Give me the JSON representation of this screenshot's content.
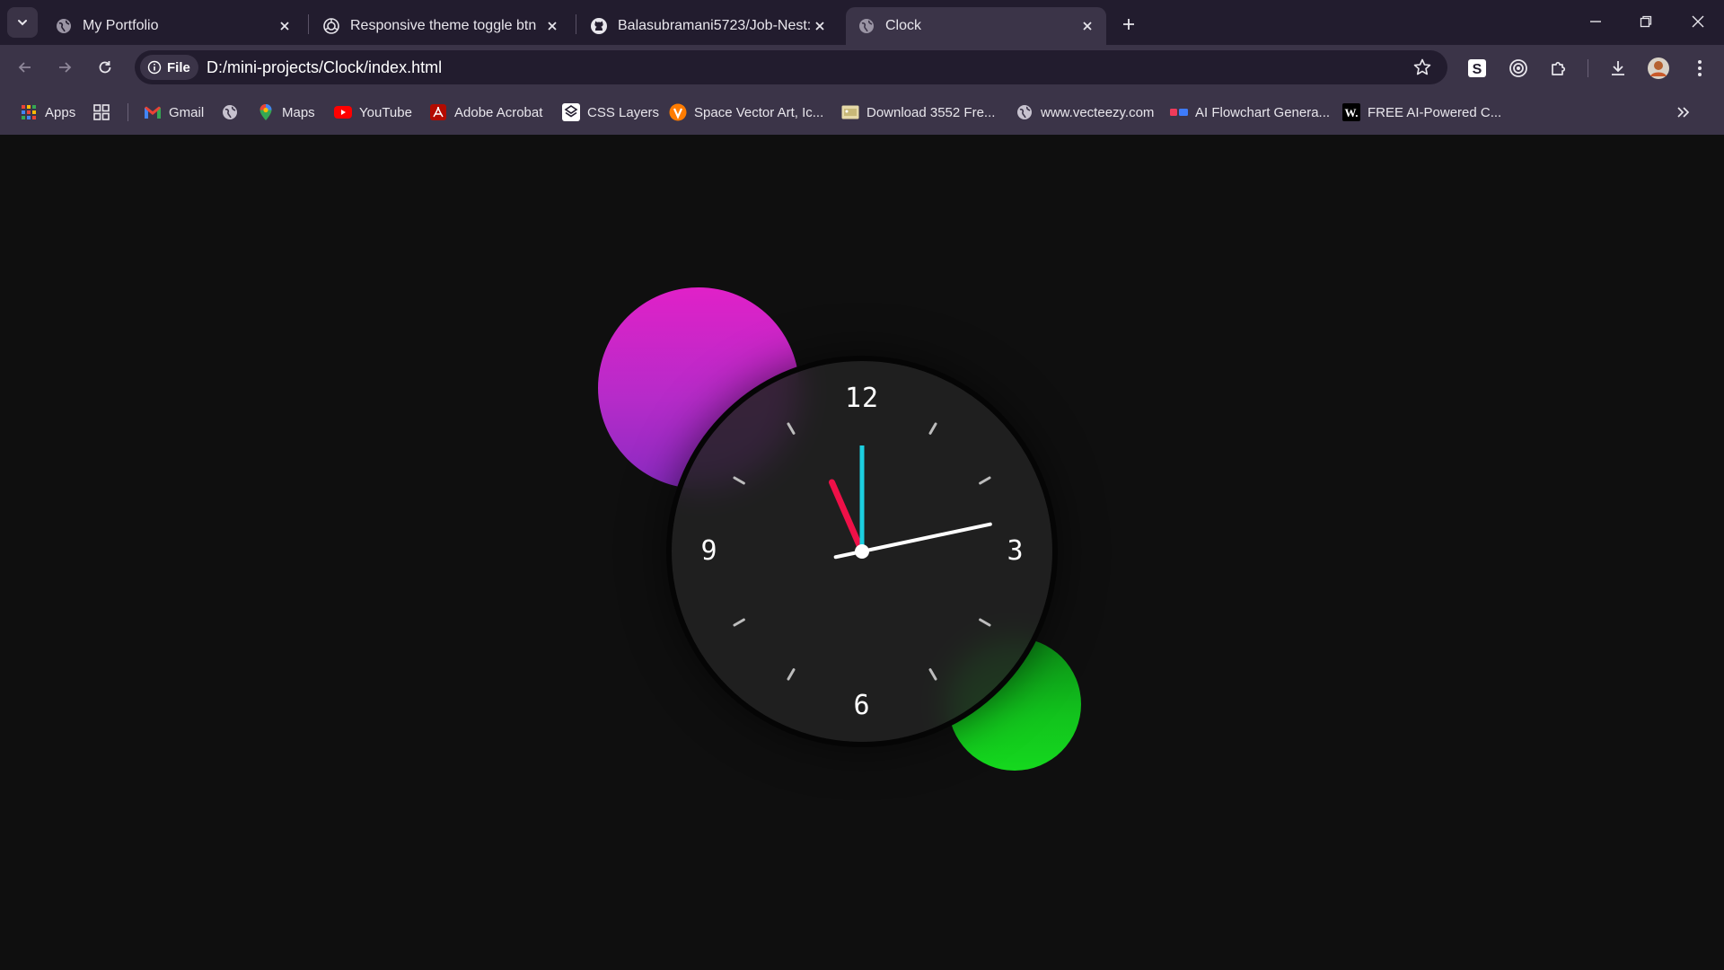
{
  "tabs": [
    {
      "title": "My Portfolio",
      "icon": "globe-icon",
      "active": false
    },
    {
      "title": "Responsive theme toggle btn",
      "icon": "openai-icon",
      "active": false
    },
    {
      "title": "Balasubramani5723/Job-Nest: J",
      "icon": "github-icon",
      "active": false
    },
    {
      "title": "Clock",
      "icon": "globe-icon",
      "active": true
    }
  ],
  "omnibox": {
    "chip_label": "File",
    "url": "D:/mini-projects/Clock/index.html"
  },
  "bookmarks": [
    {
      "label": "Apps",
      "icon": "apps-grid-icon"
    },
    {
      "label": "",
      "icon": "tab-groups-icon"
    },
    {
      "label": "Gmail",
      "icon": "gmail-icon"
    },
    {
      "label": "",
      "icon": "globe-icon"
    },
    {
      "label": "Maps",
      "icon": "maps-pin-icon"
    },
    {
      "label": "YouTube",
      "icon": "youtube-icon"
    },
    {
      "label": "Adobe Acrobat",
      "icon": "acrobat-icon"
    },
    {
      "label": "CSS Layers",
      "icon": "css-layers-icon"
    },
    {
      "label": "Space Vector Art, Ic...",
      "icon": "vecteezy-icon"
    },
    {
      "label": "Download 3552 Fre...",
      "icon": "image-icon"
    },
    {
      "label": "www.vecteezy.com",
      "icon": "globe-icon"
    },
    {
      "label": "AI Flowchart Genera...",
      "icon": "flowchart-icon"
    },
    {
      "label": "FREE AI-Powered C...",
      "icon": "w-icon"
    }
  ],
  "clock": {
    "numerals": {
      "twelve": "12",
      "three": "3",
      "six": "6",
      "nine": "9"
    },
    "time": {
      "hour": 11,
      "minute": 13,
      "second": 0
    },
    "colors": {
      "hour_hand": "#ee1048",
      "minute_hand": "#ffffff",
      "second_hand": "#1ccfe0",
      "tick": "#bdbdbd",
      "blob_pink": "#e021c8",
      "blob_green": "#15d81e"
    }
  }
}
